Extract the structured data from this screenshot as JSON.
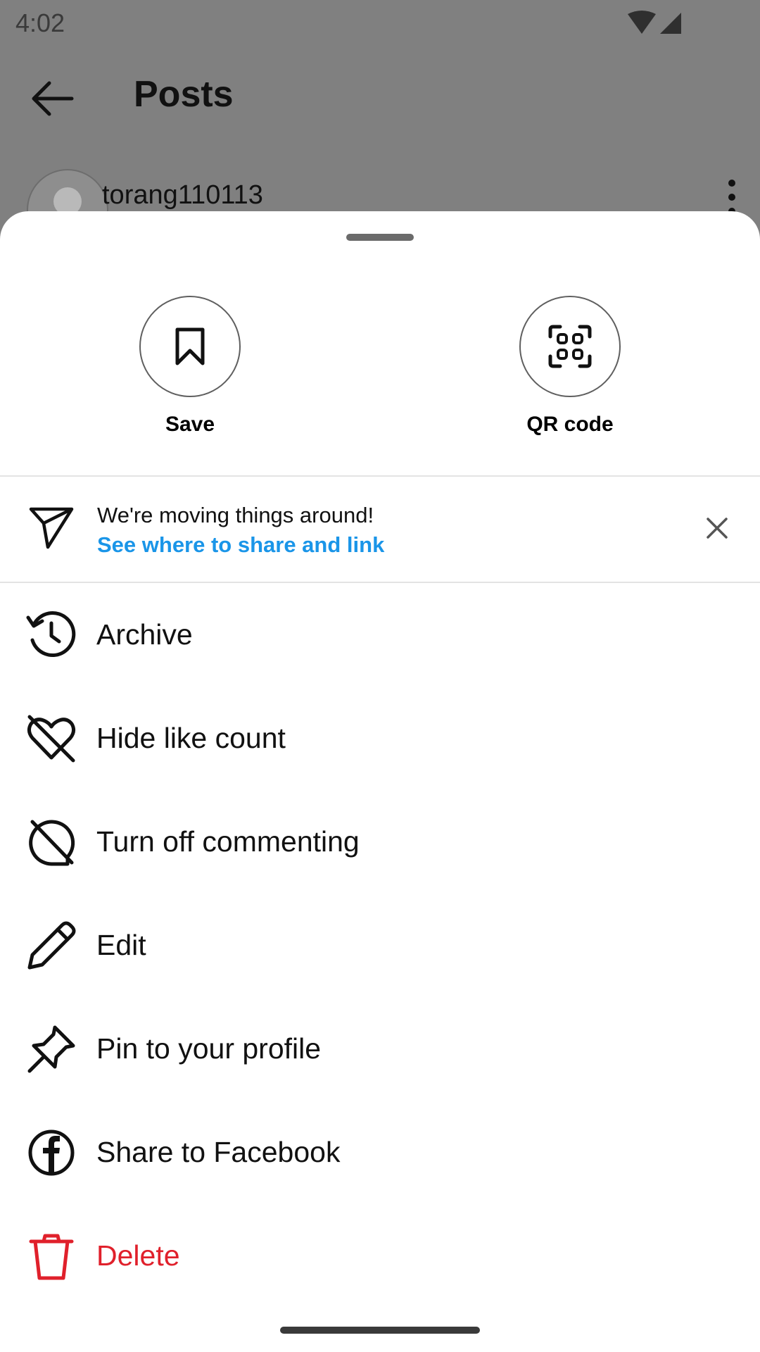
{
  "status_bar": {
    "time": "4:02"
  },
  "header": {
    "title": "Posts"
  },
  "post": {
    "username": "torang110113"
  },
  "quick_actions": [
    {
      "label": "Save",
      "icon": "bookmark-icon"
    },
    {
      "label": "QR code",
      "icon": "qr-code-icon"
    }
  ],
  "banner": {
    "title": "We're moving things around!",
    "link": "See where to share and link",
    "link_color": "#1a95e8"
  },
  "menu": [
    {
      "label": "Archive",
      "icon": "archive-clock-icon"
    },
    {
      "label": "Hide like count",
      "icon": "heart-off-icon"
    },
    {
      "label": "Turn off commenting",
      "icon": "comment-off-icon"
    },
    {
      "label": "Edit",
      "icon": "pencil-icon"
    },
    {
      "label": "Pin to your profile",
      "icon": "pin-icon"
    },
    {
      "label": "Share to Facebook",
      "icon": "facebook-icon"
    },
    {
      "label": "Delete",
      "icon": "trash-icon",
      "color": "#e0202b"
    }
  ]
}
